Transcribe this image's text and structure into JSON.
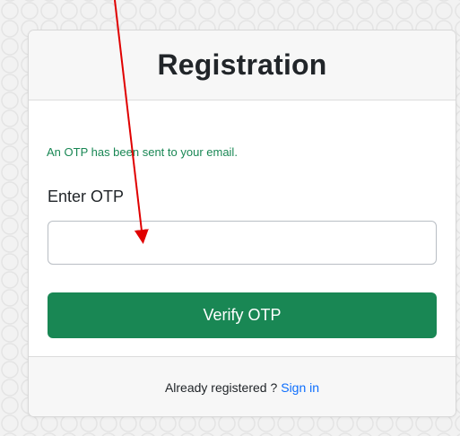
{
  "card": {
    "title": "Registration",
    "otp_message": "An OTP has been sent to your email.",
    "otp_label": "Enter OTP",
    "otp_input_value": "",
    "verify_label": "Verify OTP"
  },
  "footer": {
    "text": "Already registered ?",
    "signin_label": "Sign in"
  },
  "colors": {
    "accent": "#198754",
    "link": "#0d6efd",
    "annotation": "#e00000"
  },
  "annotation": {
    "type": "red-arrow",
    "target": "otp-input"
  }
}
